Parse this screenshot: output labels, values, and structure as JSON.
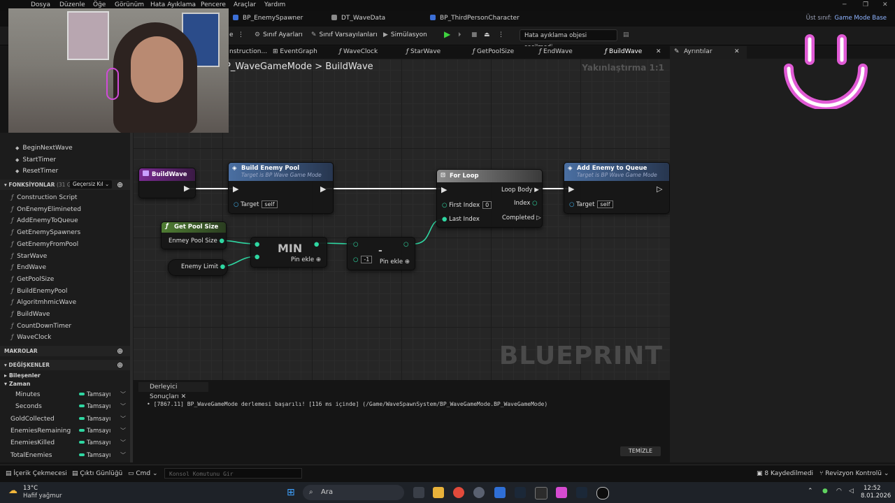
{
  "menu": [
    "Dosya",
    "Düzenle",
    "Öğe",
    "Görünüm",
    "Hata Ayıklama",
    "Pencere",
    "Araçlar",
    "Yardım"
  ],
  "doc_tabs": [
    "BP_EnemySpawner",
    "DT_WaveData",
    "BP_ThirdPersonCharacter"
  ],
  "top_right": {
    "label": "Üst sınıf:",
    "value": "Game Mode Base"
  },
  "toolbar": {
    "class_settings": "Sınıf Ayarları",
    "class_defaults": "Sınıf Varsayılanları",
    "simulation": "Simülasyon",
    "debug_select": "Hata ayıklama objesi seçilmedi"
  },
  "graph_tabs": [
    "nstruction...",
    "EventGraph",
    "WaveClock",
    "StarWave",
    "GetPoolSize",
    "EndWave",
    "BuildWave"
  ],
  "details_tab": "Ayrıntılar",
  "breadcrumb": {
    "parent": "P_WaveGameMode",
    "sep": ">",
    "current": "BuildWave"
  },
  "zoom": "Yakınlaştırma 1:1",
  "watermark": "BLUEPRINT",
  "events": [
    "BeginNextWave",
    "StartTimer",
    "ResetTimer"
  ],
  "functions_header": {
    "label": "FONKSİYONLAR",
    "count": "(31 GEÇE",
    "override": "Geçersiz Kıl"
  },
  "functions": [
    "Construction Script",
    "OnEnemyElimineted",
    "AddEnemyToQueue",
    "GetEnemySpawners",
    "GetEnemyFromPool",
    "StarWave",
    "EndWave",
    "GetPoolSize",
    "BuildEnemyPool",
    "AlgoritmhmicWave",
    "BuildWave",
    "CountDownTimer",
    "WaveClock"
  ],
  "macros_header": "MAKROLAR",
  "variables_header": "DEĞİŞKENLER",
  "var_groups": {
    "components": "Bileşenler",
    "time": "Zaman"
  },
  "variables": [
    {
      "name": "Minutes",
      "type": "Tamsayı"
    },
    {
      "name": "Seconds",
      "type": "Tamsayı"
    },
    {
      "name": "GoldCollected",
      "type": "Tamsayı"
    },
    {
      "name": "EnemiesRemaining",
      "type": "Tamsayı"
    },
    {
      "name": "EnemiesKilled",
      "type": "Tamsayı"
    },
    {
      "name": "TotalEnemies",
      "type": "Tamsayı"
    }
  ],
  "nodes": {
    "entry": {
      "title": "BuildWave"
    },
    "build_pool": {
      "title": "Build Enemy Pool",
      "sub": "Target is BP Wave Game Mode",
      "target": "Target",
      "self": "self"
    },
    "for_loop": {
      "title": "For Loop",
      "first_index": "First Index",
      "first_val": "0",
      "last_index": "Last Index",
      "loop_body": "Loop Body",
      "index": "Index",
      "completed": "Completed"
    },
    "add_enemy": {
      "title": "Add Enemy to Queue",
      "sub": "Target is BP Wave Game Mode",
      "target": "Target",
      "self": "self"
    },
    "get_pool": {
      "title": "Get Pool Size",
      "out": "Enmey Pool Size"
    },
    "enemy_limit": {
      "label": "Enemy Limit"
    },
    "min": {
      "title": "MIN",
      "add_pin": "Pin ekle"
    },
    "minus": {
      "title": "-",
      "val": "-1",
      "add_pin": "Pin ekle"
    }
  },
  "compiler": {
    "tab": "Derleyici Sonuçları",
    "message": "[7867.11] BP_WaveGameMode derlemesi başarılı! [116 ms içinde] (/Game/WaveSpawnSystem/BP_WaveGameMode.BP_WaveGameMode)",
    "clear": "TEMİZLE"
  },
  "bottom": {
    "content_drawer": "İçerik Çekmecesi",
    "output_log": "Çıktı Günlüğü",
    "cmd": "Cmd",
    "console_placeholder": "Konsol Komutunu Gir",
    "saved": "8 Kaydedilmedi",
    "revision": "Revizyon Kontrolü"
  },
  "taskbar": {
    "weather_temp": "13°C",
    "weather_desc": "Hafif yağmur",
    "search": "Ara",
    "time": "12:52",
    "date": "8.01.2026"
  },
  "colors": {
    "accent": "#2fd7a2",
    "exec_header": "#3b5a8a",
    "pure_header": "#3e6b2a",
    "event_header": "#6d2a86"
  }
}
